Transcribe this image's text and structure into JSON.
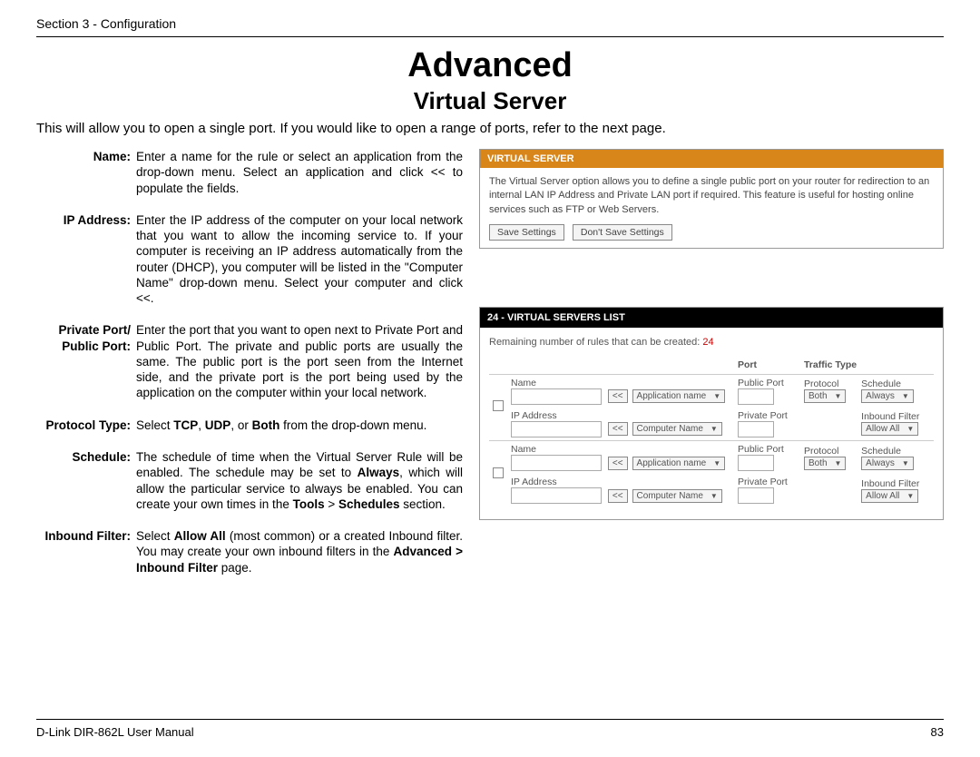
{
  "header": {
    "section_text": "Section 3 - Configuration"
  },
  "headings": {
    "main": "Advanced",
    "sub": "Virtual Server"
  },
  "intro": "This will allow you to open a single port. If you would like to open a range of ports, refer to the next page.",
  "defs": {
    "name": {
      "label": "Name:",
      "body": "Enter a name for the rule or select an application from the drop-down menu. Select an application and click << to populate the fields."
    },
    "ip": {
      "label": "IP Address:",
      "body": "Enter the IP address of the computer on your local network that you want to allow the incoming service to. If your computer is receiving an IP address automatically from the router (DHCP), you computer will be listed in the \"Computer Name\" drop-down menu. Select your computer and click <<."
    },
    "ports": {
      "label_line1": "Private Port/",
      "label_line2": "Public Port:",
      "body": "Enter the port that you want to open next to Private Port and Public Port. The private and public ports are usually the same. The public port is the port seen from the Internet side, and the private port is the port being used by the application on the computer within your local network."
    },
    "protocol": {
      "label": "Protocol Type:",
      "body_pre": "Select ",
      "tcp": "TCP",
      "sep1": ", ",
      "udp": "UDP",
      "sep2": ", or ",
      "both": "Both",
      "body_post": " from the drop-down menu."
    },
    "schedule": {
      "label": "Schedule:",
      "b1": "The schedule of time when the Virtual Server Rule will be enabled. The schedule may be set to ",
      "always": "Always",
      "b2": ", which will allow the particular service to always be enabled. You can create your own times in the ",
      "tools": "Tools",
      "b3": " > ",
      "sched": "Schedules",
      "b4": " section."
    },
    "inbound": {
      "label": "Inbound Filter:",
      "b1": "Select ",
      "allow": "Allow All",
      "b2": " (most common) or a created Inbound filter. You may create your own inbound filters in the ",
      "path": "Advanced > Inbound Filter",
      "b3": " page."
    }
  },
  "panel": {
    "title": "VIRTUAL SERVER",
    "desc": "The Virtual Server option allows you to define a single public port on your router for redirection to an internal LAN IP Address and Private LAN port if required. This feature is useful for hosting online services such as FTP or Web Servers.",
    "save": "Save Settings",
    "dont_save": "Don't Save Settings"
  },
  "list_panel": {
    "title": "24 - VIRTUAL SERVERS LIST",
    "remaining_text": "Remaining number of rules that can be created: ",
    "remaining_num": "24",
    "cols": {
      "port": "Port",
      "traffic": "Traffic Type"
    },
    "row_labels": {
      "name": "Name",
      "public": "Public Port",
      "protocol": "Protocol",
      "schedule": "Schedule",
      "ip": "IP Address",
      "private": "Private Port",
      "inbound": "Inbound Filter"
    },
    "selects": {
      "application": "Application name",
      "computer": "Computer Name",
      "both": "Both",
      "always": "Always",
      "allow_all": "Allow All"
    },
    "copy_btn": "<<"
  },
  "footer": {
    "manual": "D-Link DIR-862L User Manual",
    "pagenum": "83"
  }
}
